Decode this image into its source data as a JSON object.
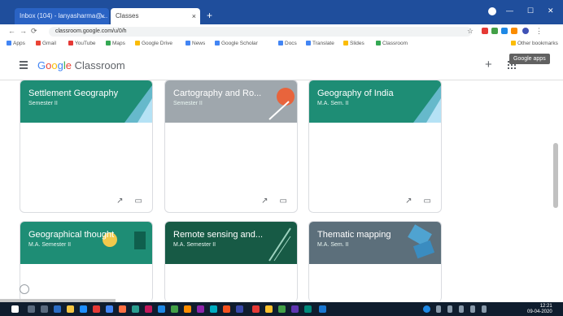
{
  "browser": {
    "tabs": [
      {
        "label": "Inbox (104) - lanyasharma@... ",
        "close": "×"
      },
      {
        "label": "Classes",
        "close": "×"
      }
    ],
    "new_tab": "+",
    "window_controls": {
      "minimize": "—",
      "maximize": "☐",
      "close": "✕"
    },
    "address": "classroom.google.com/u/0/h",
    "bookmarks": [
      "Apps",
      "Gmail",
      "YouTube",
      "Maps",
      "Google Drive",
      "News",
      "Google Scholar",
      "Docs",
      "Translate",
      "Slides",
      "Classroom",
      "Other bookmarks"
    ]
  },
  "classroom": {
    "logo_parts": [
      "G",
      "o",
      "o",
      "g",
      "l",
      "e",
      " Classroom"
    ],
    "plus": "+",
    "tooltip": "Google apps"
  },
  "courses": [
    {
      "title": "Settlement Geography",
      "subtitle": "Semester II",
      "color": "#1e8d75"
    },
    {
      "title": "Cartography and Ro...",
      "subtitle": "Semester II",
      "color": "#9fa7ad"
    },
    {
      "title": "Geography of India",
      "subtitle": "M.A. Sem. II",
      "color": "#1e8d75"
    },
    {
      "title": "Geographical thought",
      "subtitle": "M.A. Semester II",
      "color": "#1e8d75"
    },
    {
      "title": "Remote sensing and...",
      "subtitle": "M.A. Semester II",
      "color": "#175a45"
    },
    {
      "title": "Thematic mapping",
      "subtitle": "M.A. Sem. II",
      "color": "#5c6f7b"
    }
  ],
  "card_actions": {
    "trend": "↗",
    "folder": "▭"
  },
  "taskbar": {
    "time": "12:21",
    "date": "09-04-2020"
  },
  "colors": {
    "tabstrip": "#1f4e9c",
    "taskbar": "#0f1d2e",
    "teal": "#1e8d75"
  }
}
